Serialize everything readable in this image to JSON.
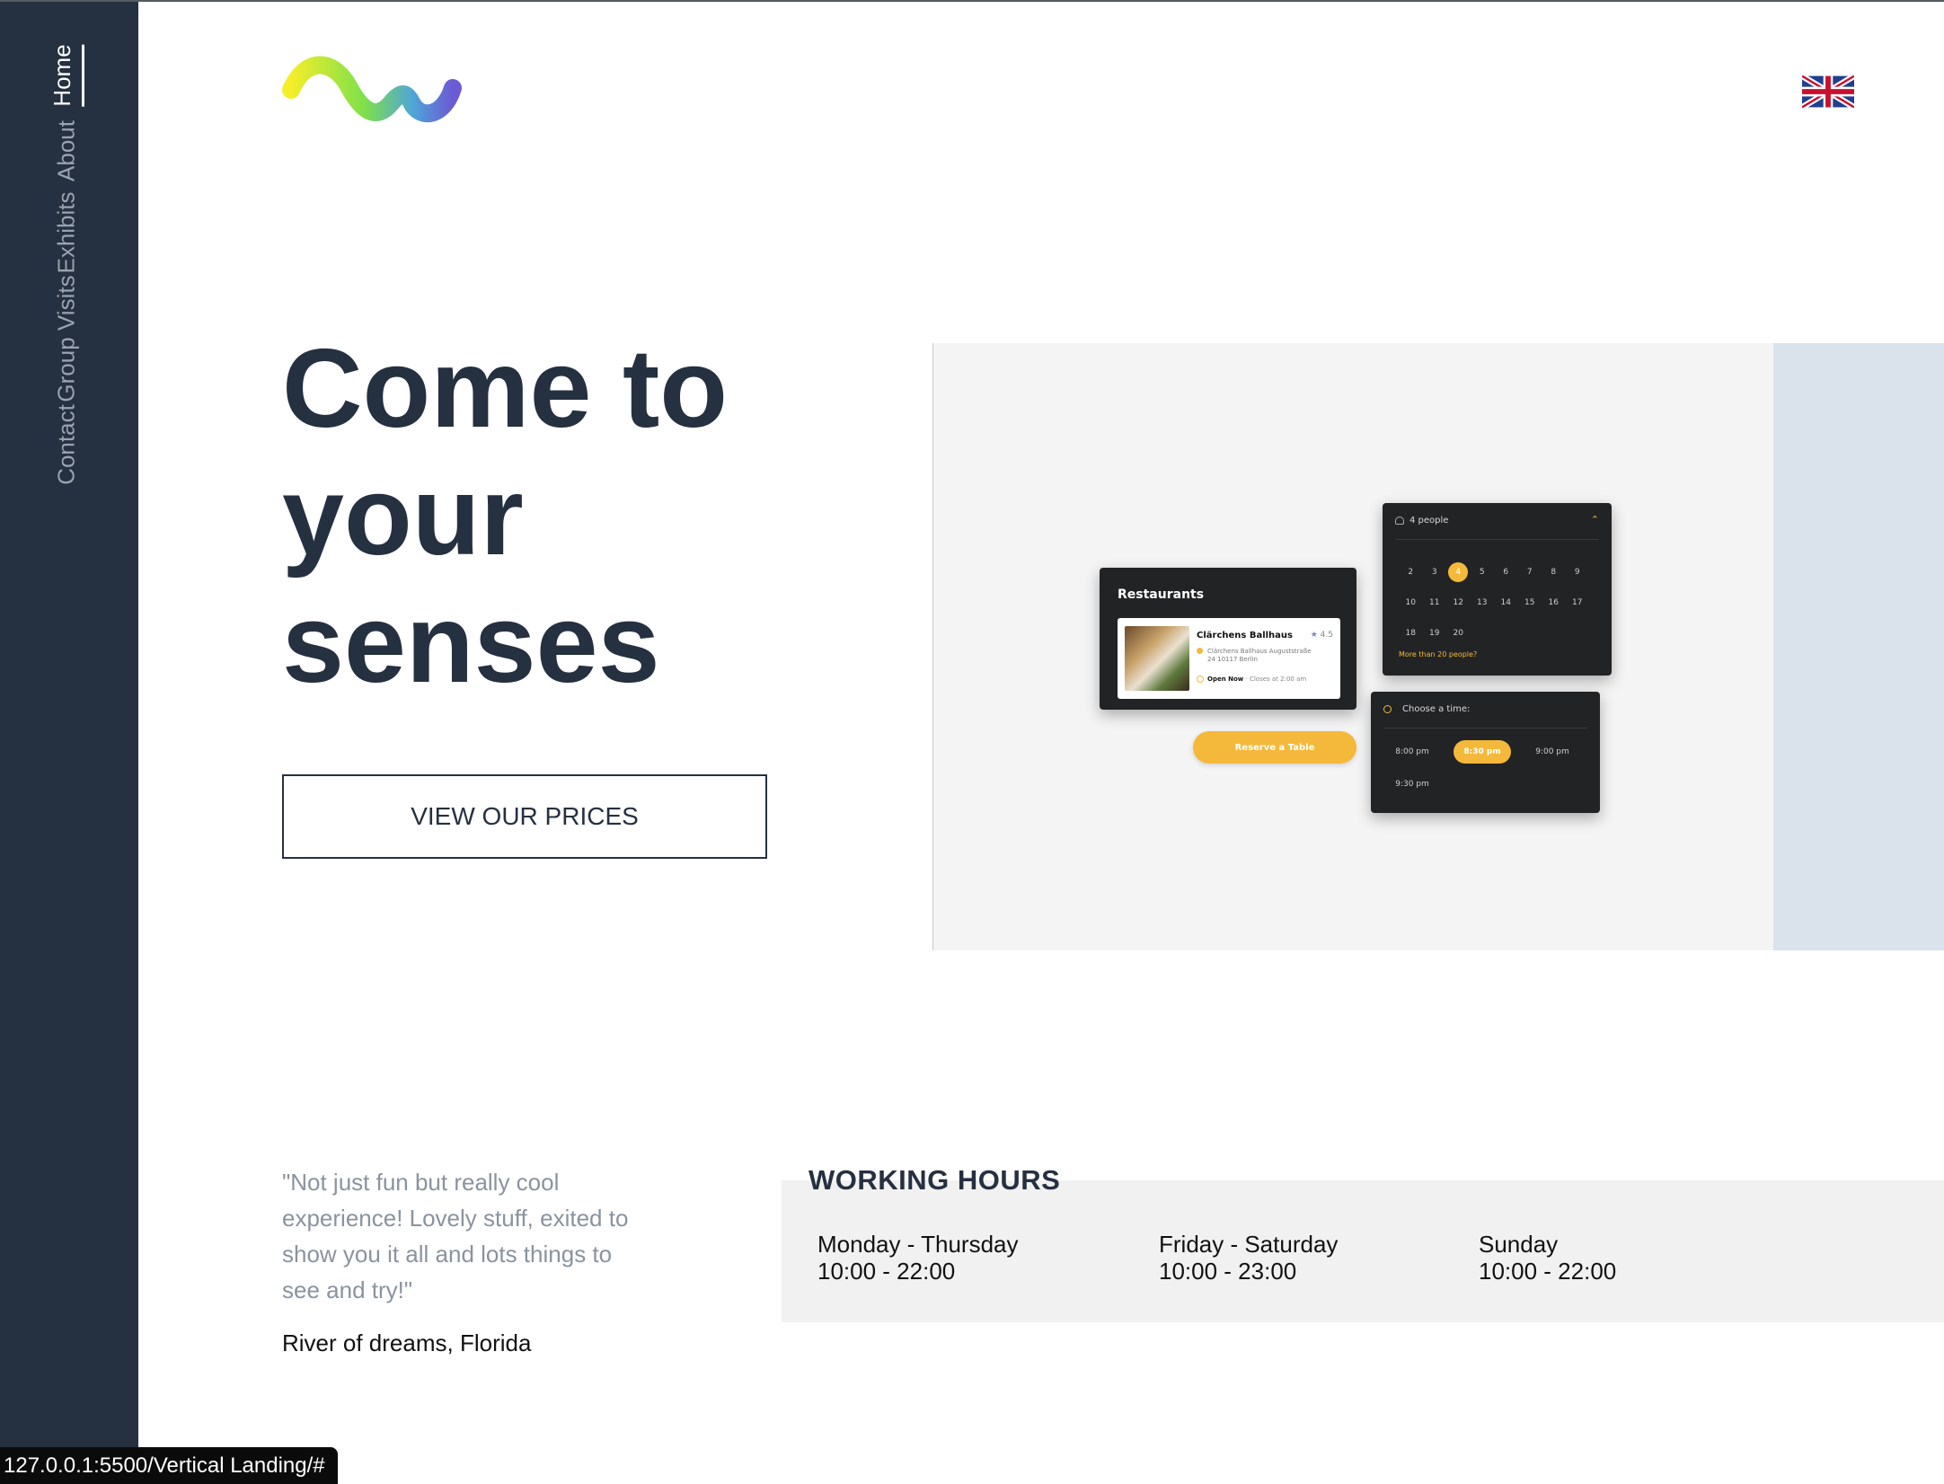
{
  "nav": {
    "items": [
      {
        "label": "Home",
        "active": true
      },
      {
        "label": "About",
        "active": false
      },
      {
        "label": "Exhibits",
        "active": false
      },
      {
        "label": "Group Visits",
        "active": false
      },
      {
        "label": "Contact",
        "active": false
      }
    ]
  },
  "header": {
    "logo_icon": "wave-logo-icon",
    "language_icon": "uk-flag-icon"
  },
  "hero": {
    "title_lines": [
      "Come to",
      "your",
      "senses"
    ],
    "cta_label": "VIEW OUR PRICES"
  },
  "showcase": {
    "restaurants_title": "Restaurants",
    "restaurant": {
      "name": "Clärchens Ballhaus",
      "rating": "4.5",
      "address_line1": "Clärchens Ballhaus Auguststraße",
      "address_line2": "24 10117 Berlin",
      "open_label": "Open Now",
      "closes_text": "· Closes at 2:00 am"
    },
    "reserve_label": "Reserve a Table",
    "people_label": "4 people",
    "days": [
      [
        "2",
        "3",
        "4",
        "5",
        "6",
        "7",
        "8",
        "9"
      ],
      [
        "10",
        "11",
        "12",
        "13",
        "14",
        "15",
        "16",
        "17"
      ],
      [
        "18",
        "19",
        "20"
      ]
    ],
    "selected_day": "4",
    "more_people": "More than 20 people?",
    "time_label": "Choose a time:",
    "times": [
      "8:00 pm",
      "8:30 pm",
      "9:00 pm",
      "9:30 pm"
    ],
    "selected_time": "8:30 pm"
  },
  "testimonial": {
    "quote": "\"Not just fun but really cool experience! Lovely stuff, exited to show you it all and lots things to see and try!\"",
    "author": "River of dreams, Florida"
  },
  "working_hours": {
    "title": "WORKING HOURS",
    "entries": [
      {
        "days": "Monday - Thursday",
        "hours": "10:00 - 22:00"
      },
      {
        "days": "Friday - Saturday",
        "hours": "10:00 - 23:00"
      },
      {
        "days": "Sunday",
        "hours": "10:00 - 22:00"
      }
    ]
  },
  "status_url": "127.0.0.1:5500/Vertical Landing/#",
  "colors": {
    "sidebar": "#253041",
    "accent": "#f4b93a",
    "text_dark": "#253041",
    "showcase_bg": "#f4f4f4",
    "accent_block": "#dae3ec"
  }
}
